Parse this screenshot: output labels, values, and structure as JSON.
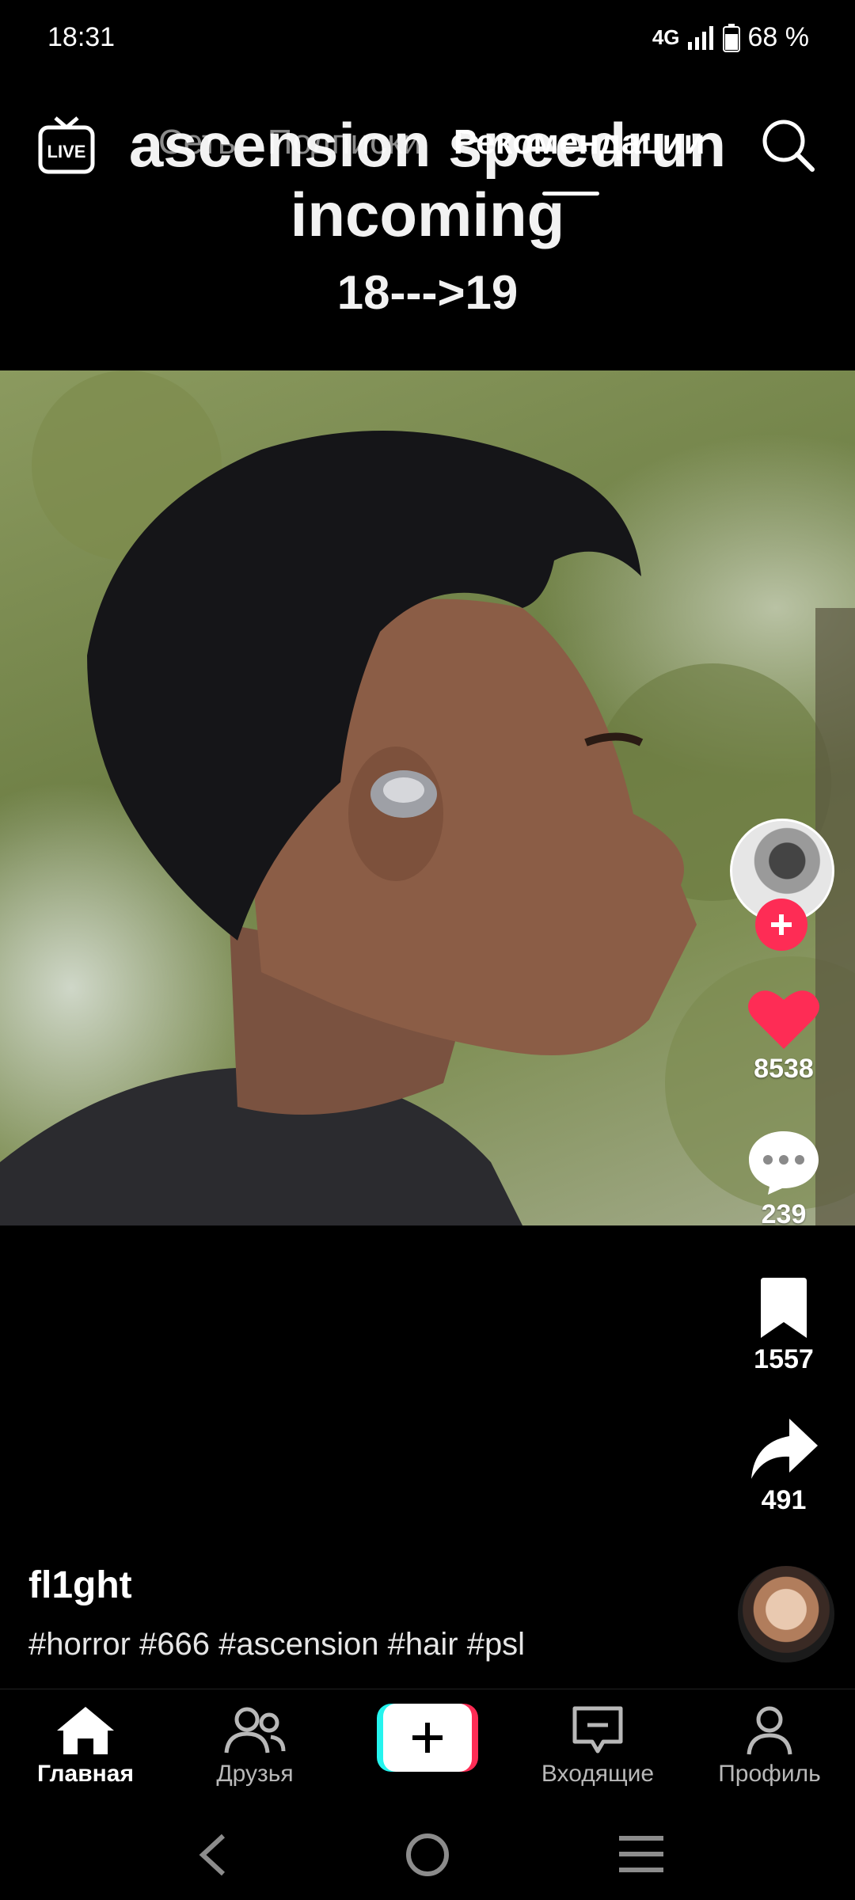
{
  "status_bar": {
    "time": "18:31",
    "network": "4G",
    "battery": "68 %"
  },
  "video_caption": {
    "line1": "ascension speedrun",
    "line2": "incoming",
    "line3": "18--->19"
  },
  "top_nav": {
    "live_label": "LIVE",
    "tabs": [
      {
        "label": "Сеть"
      },
      {
        "label": "Подписки"
      },
      {
        "label": "Рекомендации"
      }
    ]
  },
  "actions": {
    "likes": "8538",
    "comments": "239",
    "saves": "1557",
    "shares": "491"
  },
  "post": {
    "author": "fl1ght",
    "hashtags": "#horror #666 #ascension #hair #psl"
  },
  "bottom_nav": {
    "home": "Главная",
    "friends": "Друзья",
    "inbox": "Входящие",
    "profile": "Профиль"
  },
  "colors": {
    "accent": "#fe2c55",
    "like": "#fe2c55",
    "cyan": "#25f4ee"
  },
  "icons": [
    "live-icon",
    "search-icon",
    "heart-icon",
    "comment-icon",
    "bookmark-icon",
    "share-icon",
    "home-icon",
    "friends-icon",
    "plus-icon",
    "inbox-icon",
    "profile-icon",
    "back-icon",
    "home-circle-icon",
    "recents-icon"
  ]
}
